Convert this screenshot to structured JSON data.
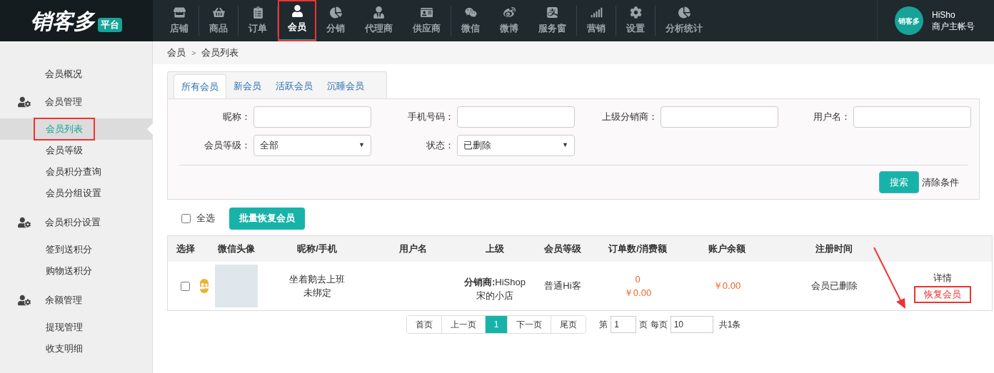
{
  "logo": {
    "text": "销客多",
    "badge": "平台"
  },
  "nav": [
    {
      "label": "店铺",
      "selected": false,
      "marked": false
    },
    {
      "label": "商品",
      "selected": false,
      "marked": false
    },
    {
      "label": "订单",
      "selected": false,
      "marked": false
    },
    {
      "label": "会员",
      "selected": true,
      "marked": true
    },
    {
      "label": "分销",
      "selected": false,
      "marked": false
    },
    {
      "label": "代理商",
      "selected": false,
      "marked": false
    },
    {
      "label": "供应商",
      "selected": false,
      "marked": false
    },
    {
      "label": "微信",
      "selected": false,
      "marked": false
    },
    {
      "label": "微博",
      "selected": false,
      "marked": false
    },
    {
      "label": "服务窗",
      "selected": false,
      "marked": false
    },
    {
      "label": "营销",
      "selected": false,
      "marked": false
    },
    {
      "label": "设置",
      "selected": false,
      "marked": false
    },
    {
      "label": "分析统计",
      "selected": false,
      "marked": false
    }
  ],
  "user": {
    "avatar_text": "销客多",
    "name": "HiSho",
    "role": "商户主帐号"
  },
  "sidebar": {
    "groups": [
      {
        "title": "会员概况"
      },
      {
        "title": "会员管理",
        "items": [
          {
            "label": "会员列表",
            "selected": true,
            "marked": true
          },
          {
            "label": "会员等级",
            "selected": false,
            "marked": false
          },
          {
            "label": "会员积分查询",
            "selected": false,
            "marked": false
          },
          {
            "label": "会员分组设置",
            "selected": false,
            "marked": false
          }
        ]
      },
      {
        "title": "会员积分设置",
        "items": [
          {
            "label": "签到送积分",
            "selected": false,
            "marked": false
          },
          {
            "label": "购物送积分",
            "selected": false,
            "marked": false
          }
        ]
      },
      {
        "title": "余额管理",
        "items": [
          {
            "label": "提现管理",
            "selected": false,
            "marked": false
          },
          {
            "label": "收支明细",
            "selected": false,
            "marked": false
          }
        ]
      }
    ]
  },
  "breadcrumb": [
    "会员",
    "会员列表"
  ],
  "breadcrumb_separator": ">",
  "tabs": [
    {
      "label": "所有会员",
      "selected": true
    },
    {
      "label": "新会员",
      "selected": false
    },
    {
      "label": "活跃会员",
      "selected": false
    },
    {
      "label": "沉睡会员",
      "selected": false
    }
  ],
  "filters": [
    {
      "kind": "text",
      "label": "昵称："
    },
    {
      "kind": "text",
      "label": "手机号码："
    },
    {
      "kind": "text",
      "label": "上级分销商："
    },
    {
      "kind": "text",
      "label": "用户名："
    },
    {
      "kind": "select",
      "label": "会员等级：",
      "value": "全部",
      "arrow": "▼"
    },
    {
      "kind": "select",
      "label": "状态：",
      "value": "已删除",
      "arrow": "▼"
    }
  ],
  "search_button": "搜索",
  "clear_link": "清除条件",
  "select_all": {
    "label": "全选",
    "checked": false
  },
  "bulk_button": "批量恢复会员",
  "table": {
    "columns": [
      "选择",
      "微信头像",
      "昵称/手机",
      "用户名",
      "上级",
      "会员等级",
      "订单数/消费额",
      "账户余额",
      "注册时间"
    ],
    "rows": [
      {
        "checked": false,
        "nickname": "坐着鹅去上班",
        "phone": "未绑定",
        "parent_label": "分销商:",
        "parent_name": "HiShop",
        "parent_shop": "宋的小店",
        "level": "普通Hi客",
        "orders": "0",
        "spent": "￥0.00",
        "balance": "￥0.00",
        "registered": "会员已删除",
        "actions": [
          {
            "label": "详情",
            "kind": "link",
            "marked": false
          },
          {
            "label": "恢复会员",
            "kind": "danger",
            "marked": true
          }
        ]
      }
    ]
  },
  "pagination": [
    {
      "label": "首页",
      "selected": false
    },
    {
      "label": "上一页",
      "selected": false
    },
    {
      "label": "1",
      "selected": true
    },
    {
      "label": "下一页",
      "selected": false
    },
    {
      "label": "尾页",
      "selected": false
    }
  ],
  "page_jump": {
    "prefix": "第",
    "value": "1",
    "middle": "页 每页",
    "per_page": "10",
    "total": "共1条"
  }
}
